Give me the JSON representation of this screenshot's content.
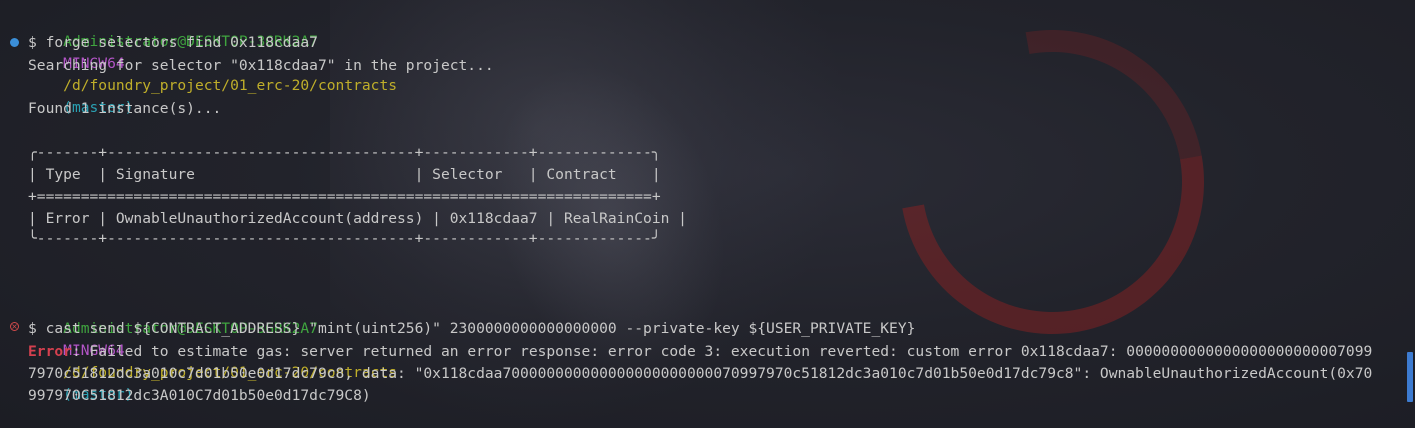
{
  "prompt": {
    "user": "Administrator@DESKTOP-3GRK2A7",
    "env": "MINGW64",
    "path": "/d/foundry_project/01_erc-20/contracts",
    "branch": "(master)"
  },
  "commands": [
    {
      "text": "$ forge selectors find 0x118cdaa7",
      "status": "success"
    },
    {
      "text": "$ cast send ${CONTRACT_ADDRESS} \"mint(uint256)\" 2300000000000000000 --private-key ${USER_PRIVATE_KEY}",
      "status": "error"
    }
  ],
  "output": {
    "searching": "Searching for selector \"0x118cdaa7\" in the project...",
    "found": "Found 1 instance(s)...",
    "table": {
      "top_border": "╭-------+-----------------------------------+------------+-------------╮",
      "header": "| Type  | Signature                         | Selector   | Contract    |",
      "separator": "+======================================================================+",
      "row": "| Error | OwnableUnauthorizedAccount(address) | 0x118cdaa7 | RealRainCoin |",
      "bottom_border": "╰-------+-----------------------------------+------------+-------------╯"
    },
    "error_label": "Error",
    "error_line1": ": Failed to estimate gas: server returned an error response: error code 3: execution reverted: custom error 0x118cdaa7: 0000000000000000000000007099",
    "error_line2": "7970c51812dc3a010c7d01b50e0d17dc79c8, data: \"0x118cdaa700000000000000000000000070997970c51812dc3a010c7d01b50e0d17dc79c8\": OwnableUnauthorizedAccount(0x70",
    "error_line3": "997970C51812dc3A010C7d01b50e0d17dc79C8)"
  },
  "colors": {
    "user": "#3fa53f",
    "env": "#b455c8",
    "path": "#bfae2a",
    "branch": "#2aa1b3",
    "error": "#d5404f",
    "text": "#c8c8c8"
  }
}
